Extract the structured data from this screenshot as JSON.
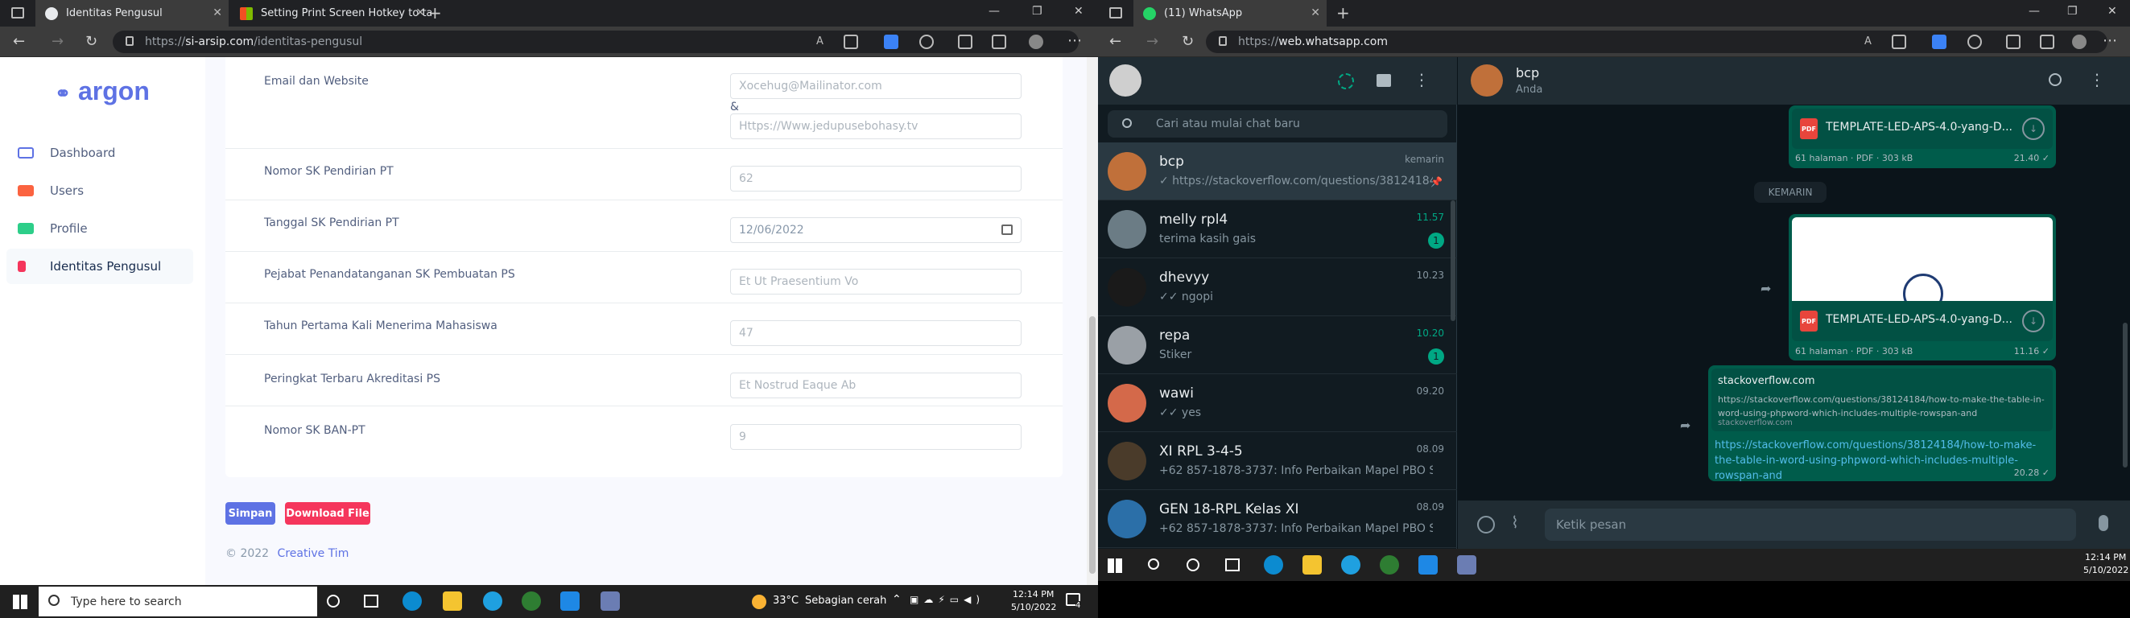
{
  "left_browser": {
    "tabs": [
      {
        "title": "Identitas Pengusul"
      },
      {
        "title": "Setting Print Screen Hotkey to ta"
      }
    ],
    "url_prefix": "https://",
    "url_host": "si-arsip.com",
    "url_path": "/identitas-pengusul",
    "logo": "argon",
    "sidebar": [
      {
        "label": "Dashboard",
        "color": "#5e72e4"
      },
      {
        "label": "Users",
        "color": "#fb6340"
      },
      {
        "label": "Profile",
        "color": "#2dce89"
      },
      {
        "label": "Identitas Pengusul",
        "color": "#f5365c"
      }
    ],
    "form": {
      "email_label": "Email dan Website",
      "email_value": "Xocehug@Mailinator.com",
      "amp": "&",
      "website_value": "Https://Www.jedupusebohasy.tv",
      "sk_label": "Nomor SK Pendirian PT",
      "sk_value": "62",
      "tgl_label": "Tanggal SK Pendirian PT",
      "tgl_value": "12/06/2022",
      "pejabat_label": "Pejabat Penandatanganan SK Pembuatan PS",
      "pejabat_value": "Et Ut Praesentium Vo",
      "tahun_label": "Tahun Pertama Kali Menerima Mahasiswa",
      "tahun_value": "47",
      "peringkat_label": "Peringkat Terbaru Akreditasi PS",
      "peringkat_value": "Et Nostrud Eaque Ab",
      "ban_label": "Nomor SK BAN-PT",
      "ban_value": "9"
    },
    "buttons": {
      "save": "Simpan",
      "download": "Download File"
    },
    "footer": {
      "copyright": "© 2022",
      "team": "Creative Tim"
    },
    "taskbar": {
      "search": "Type here to search",
      "weather_temp": "33°C",
      "weather_desc": "Sebagian cerah",
      "time": "12:14 PM",
      "date": "5/10/2022",
      "notifications": "4"
    }
  },
  "right_browser": {
    "tab": {
      "title": "(11) WhatsApp"
    },
    "url_prefix": "https://",
    "url_host": "web.whatsapp.com",
    "search_placeholder": "Cari atau mulai chat baru",
    "chats": [
      {
        "name": "bcp",
        "msg": "✓ https://stackoverflow.com/questions/38124184/h...",
        "time": "kemarin",
        "badge": "",
        "avatar": "#c0703a"
      },
      {
        "name": "melly rpl4",
        "msg": "terima kasih gais",
        "time": "11.57",
        "badge": "1",
        "avatar": "#6b7c85"
      },
      {
        "name": "dhevyy",
        "msg": "✓✓ ngopi",
        "time": "10.23",
        "badge": "",
        "avatar": "#1a1a1a"
      },
      {
        "name": "repa",
        "msg": "Stiker",
        "time": "10.20",
        "badge": "1",
        "avatar": "#9aa0a6"
      },
      {
        "name": "wawi",
        "msg": "✓✓ yes",
        "time": "09.20",
        "badge": "",
        "avatar": "#d4694a"
      },
      {
        "name": "XI RPL 3-4-5",
        "msg": "+62 857-1878-3737: Info Perbaikan Mapel PBO Sila...",
        "time": "08.09",
        "badge": "",
        "avatar": "#4a3b2a"
      },
      {
        "name": "GEN 18-RPL Kelas XI",
        "msg": "+62 857-1878-3737: Info Perbaikan Mapel PBO Sila...",
        "time": "08.09",
        "badge": "",
        "avatar": "#2b6fa8"
      }
    ],
    "conversation": {
      "name": "bcp",
      "status": "Anda",
      "pdf1_name": "TEMPLATE-LED-APS-4.0-yang-D...",
      "pdf1_meta": "61 halaman · PDF · 303 kB",
      "pdf1_time": "21.40 ✓",
      "day_chip": "KEMARIN",
      "pdf2_name": "TEMPLATE-LED-APS-4.0-yang-D...",
      "pdf2_meta": "61 halaman · PDF · 303 kB",
      "pdf2_time": "11.16 ✓",
      "link_title": "stackoverflow.com",
      "link_desc": "https://stackoverflow.com/questions/38124184/how-to-make-the-table-in-word-using-phpword-which-includes-multiple-rowspan-and",
      "link_domain": "stackoverflow.com",
      "link_url": "https://stackoverflow.com/questions/38124184/how-to-make-the-table-in-word-using-phpword-which-includes-multiple-rowspan-and",
      "link_time": "20.28 ✓",
      "input_placeholder": "Ketik pesan"
    },
    "taskbar": {
      "time": "12:14 PM",
      "date": "5/10/2022"
    }
  }
}
